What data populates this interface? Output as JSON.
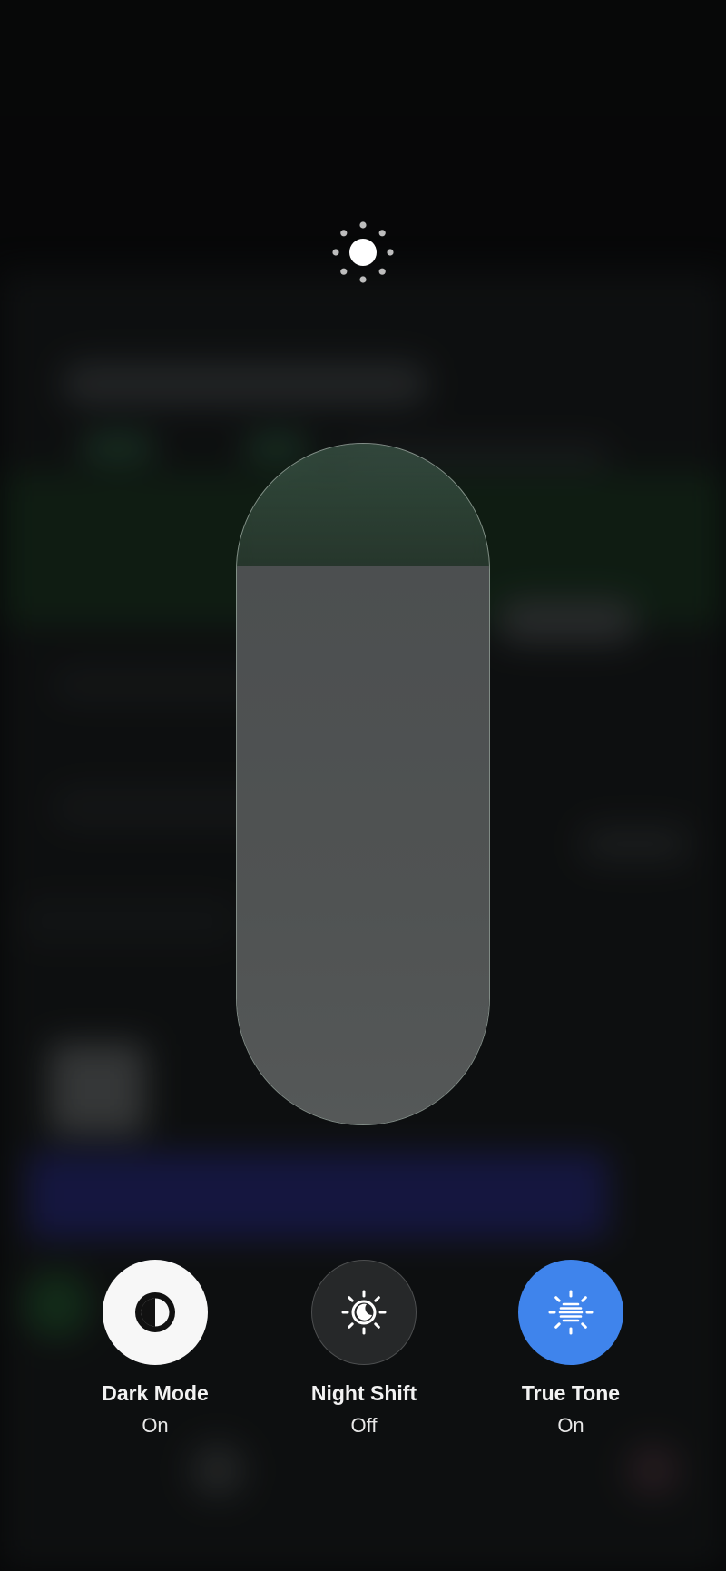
{
  "brightness": {
    "level": 0.82,
    "icon": "sun-icon"
  },
  "toggles": [
    {
      "label": "Dark Mode",
      "state": "On",
      "icon": "dark-mode-icon",
      "color": "#f7f7f7"
    },
    {
      "label": "Night Shift",
      "state": "Off",
      "icon": "night-shift-icon",
      "color": "#28292a"
    },
    {
      "label": "True Tone",
      "state": "On",
      "icon": "true-tone-icon",
      "color": "#3f84ec"
    }
  ]
}
